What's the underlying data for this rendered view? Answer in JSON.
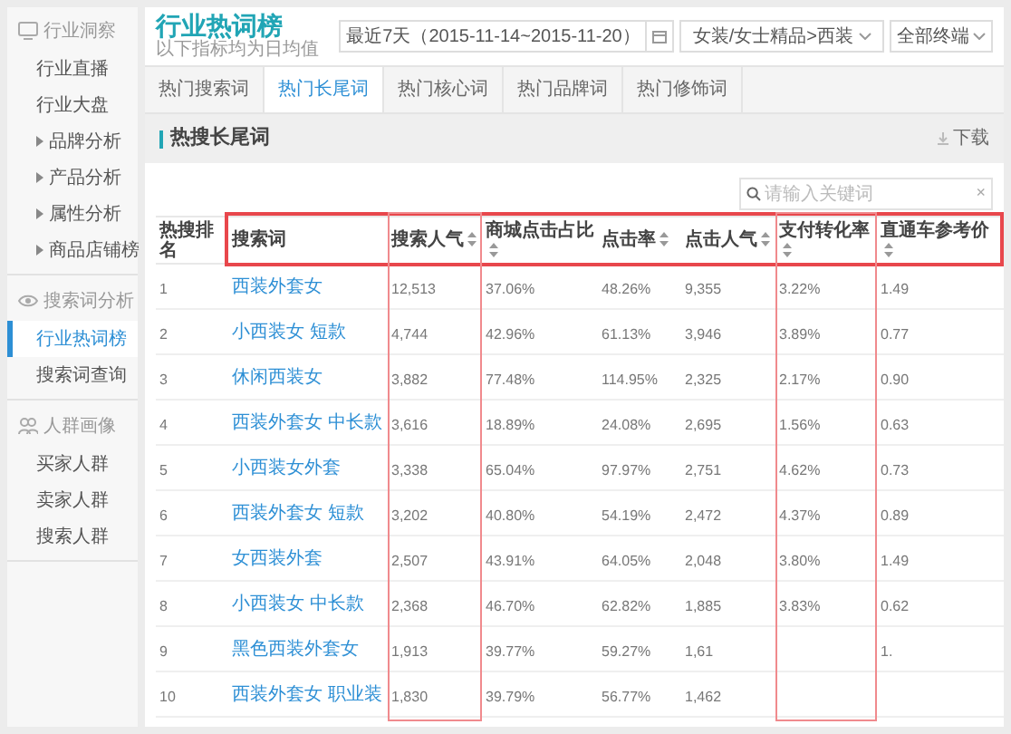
{
  "sidebar": {
    "sections": [
      {
        "title": "行业洞察",
        "kind": "monitor",
        "items": [
          {
            "label": "行业直播",
            "expandable": false,
            "selected": false
          },
          {
            "label": "行业大盘",
            "expandable": false,
            "selected": false
          },
          {
            "label": "品牌分析",
            "expandable": true,
            "selected": false
          },
          {
            "label": "产品分析",
            "expandable": true,
            "selected": false
          },
          {
            "label": "属性分析",
            "expandable": true,
            "selected": false
          },
          {
            "label": "商品店铺榜",
            "expandable": true,
            "selected": false
          }
        ]
      },
      {
        "title": "搜索词分析",
        "kind": "eye",
        "items": [
          {
            "label": "行业热词榜",
            "expandable": false,
            "selected": true
          },
          {
            "label": "搜索词查询",
            "expandable": false,
            "selected": false
          }
        ]
      },
      {
        "title": "人群画像",
        "kind": "people",
        "items": [
          {
            "label": "买家人群",
            "expandable": false,
            "selected": false
          },
          {
            "label": "卖家人群",
            "expandable": false,
            "selected": false
          },
          {
            "label": "搜索人群",
            "expandable": false,
            "selected": false
          }
        ]
      }
    ]
  },
  "header": {
    "title": "行业热词榜",
    "subtitle": "以下指标均为日均值",
    "date_range": "最近7天（2015-11-14~2015-11-20）",
    "category": "女装/女士精品>西装",
    "terminal": "全部终端"
  },
  "tabs": [
    {
      "label": "热门搜索词",
      "selected": false
    },
    {
      "label": "热门长尾词",
      "selected": true
    },
    {
      "label": "热门核心词",
      "selected": false
    },
    {
      "label": "热门品牌词",
      "selected": false
    },
    {
      "label": "热门修饰词",
      "selected": false
    }
  ],
  "section": {
    "title": "热搜长尾词",
    "download": "下载"
  },
  "search": {
    "placeholder": "请输入关键词",
    "clear": "×"
  },
  "table": {
    "columns": [
      {
        "label": "热搜排名",
        "sortable": false,
        "kind": "text"
      },
      {
        "label": "搜索词",
        "sortable": false,
        "kind": "link"
      },
      {
        "label": "搜索人气",
        "sortable": true,
        "kind": "text"
      },
      {
        "label": "商城点击占比",
        "sortable": true,
        "kind": "text"
      },
      {
        "label": "点击率",
        "sortable": true,
        "kind": "text"
      },
      {
        "label": "点击人气",
        "sortable": true,
        "kind": "text"
      },
      {
        "label": "支付转化率",
        "sortable": true,
        "kind": "text"
      },
      {
        "label": "直通车参考价",
        "sortable": true,
        "kind": "text"
      }
    ],
    "rows": [
      [
        "1",
        "西装外套女",
        "12,513",
        "37.06%",
        "48.26%",
        "9,355",
        "3.22%",
        "1.49"
      ],
      [
        "2",
        "小西装女 短款",
        "4,744",
        "42.96%",
        "61.13%",
        "3,946",
        "3.89%",
        "0.77"
      ],
      [
        "3",
        "休闲西装女",
        "3,882",
        "77.48%",
        "114.95%",
        "2,325",
        "2.17%",
        "0.90"
      ],
      [
        "4",
        "西装外套女 中长款",
        "3,616",
        "18.89%",
        "24.08%",
        "2,695",
        "1.56%",
        "0.63"
      ],
      [
        "5",
        "小西装女外套",
        "3,338",
        "65.04%",
        "97.97%",
        "2,751",
        "4.62%",
        "0.73"
      ],
      [
        "6",
        "西装外套女 短款",
        "3,202",
        "40.80%",
        "54.19%",
        "2,472",
        "4.37%",
        "0.89"
      ],
      [
        "7",
        "女西装外套",
        "2,507",
        "43.91%",
        "64.05%",
        "2,048",
        "3.80%",
        "1.49"
      ],
      [
        "8",
        "小西装女 中长款",
        "2,368",
        "46.70%",
        "62.82%",
        "1,885",
        "3.83%",
        "0.62"
      ],
      [
        "9",
        "黑色西装外套女",
        "1,913",
        "39.77%",
        "59.27%",
        "1,61",
        null,
        "1."
      ],
      [
        "10",
        "西装外套女 职业装",
        "1,830",
        "39.79%",
        "56.77%",
        "1,462",
        null,
        null
      ]
    ]
  }
}
